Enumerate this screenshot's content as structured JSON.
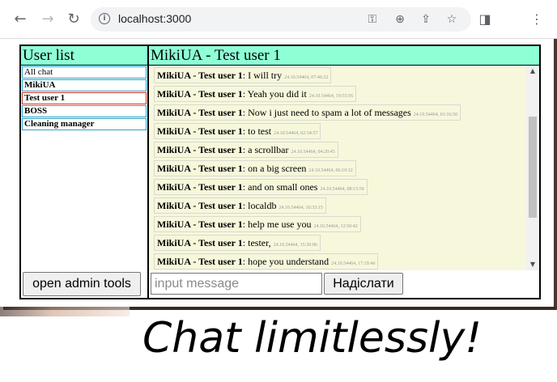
{
  "browser": {
    "url": "localhost:3000",
    "icons": [
      "back-arrow-icon",
      "forward-arrow-icon",
      "reload-icon",
      "info-icon",
      "key-icon",
      "zoom-icon",
      "share-icon",
      "star-icon",
      "sidebar-icon",
      "kebab-menu-icon"
    ]
  },
  "sidebar": {
    "title": "User list",
    "users": [
      {
        "label": "All chat",
        "bold": false,
        "active": false
      },
      {
        "label": "MikiUA",
        "bold": true,
        "active": false
      },
      {
        "label": "Test user 1",
        "bold": true,
        "active": true
      },
      {
        "label": "BOSS",
        "bold": true,
        "active": false
      },
      {
        "label": "Cleaning manager",
        "bold": true,
        "active": false
      }
    ],
    "admin_button": "open admin tools"
  },
  "chat": {
    "title": "MikiUA - Test user 1",
    "messages": [
      {
        "author": "MikiUA - Test user 1",
        "text": ": I will try",
        "ts": "24.10.54464, 07:46:22"
      },
      {
        "author": "MikiUA - Test user 1",
        "text": ": Yeah you did it",
        "ts": "24.10.54464, 19:55:56"
      },
      {
        "author": "MikiUA - Test user 1",
        "text": ": Now i just need to spam a lot of messages",
        "ts": "24.10.54464, 01:16:50"
      },
      {
        "author": "MikiUA - Test user 1",
        "text": ": to test",
        "ts": "24.10.54464, 02:34:57"
      },
      {
        "author": "MikiUA - Test user 1",
        "text": ": a scrollbar",
        "ts": "24.10.54464, 04:20:45"
      },
      {
        "author": "MikiUA - Test user 1",
        "text": ": on a big screen",
        "ts": "24.10.54464, 06:10:32"
      },
      {
        "author": "MikiUA - Test user 1",
        "text": ": and on small ones",
        "ts": "24.10.54464, 08:15:59"
      },
      {
        "author": "MikiUA - Test user 1",
        "text": ": localdb",
        "ts": "24.10.54464, 10:33:15"
      },
      {
        "author": "MikiUA - Test user 1",
        "text": ": help me use you",
        "ts": "24.10.54464, 12:50:42"
      },
      {
        "author": "MikiUA - Test user 1",
        "text": ": tester,",
        "ts": "24.10.54464, 15:30:06"
      },
      {
        "author": "MikiUA - Test user 1",
        "text": ": hope you understand",
        "ts": "24.10.54464, 17:19:46"
      }
    ],
    "input_placeholder": "input message",
    "send_label": "Надіслати"
  },
  "slogan": "Chat limitlessly!",
  "colors": {
    "header_bg": "#8fffd6",
    "chat_bg": "#f7f7dc",
    "user_border": "#2ea3c7",
    "active_border": "#c0392b"
  }
}
